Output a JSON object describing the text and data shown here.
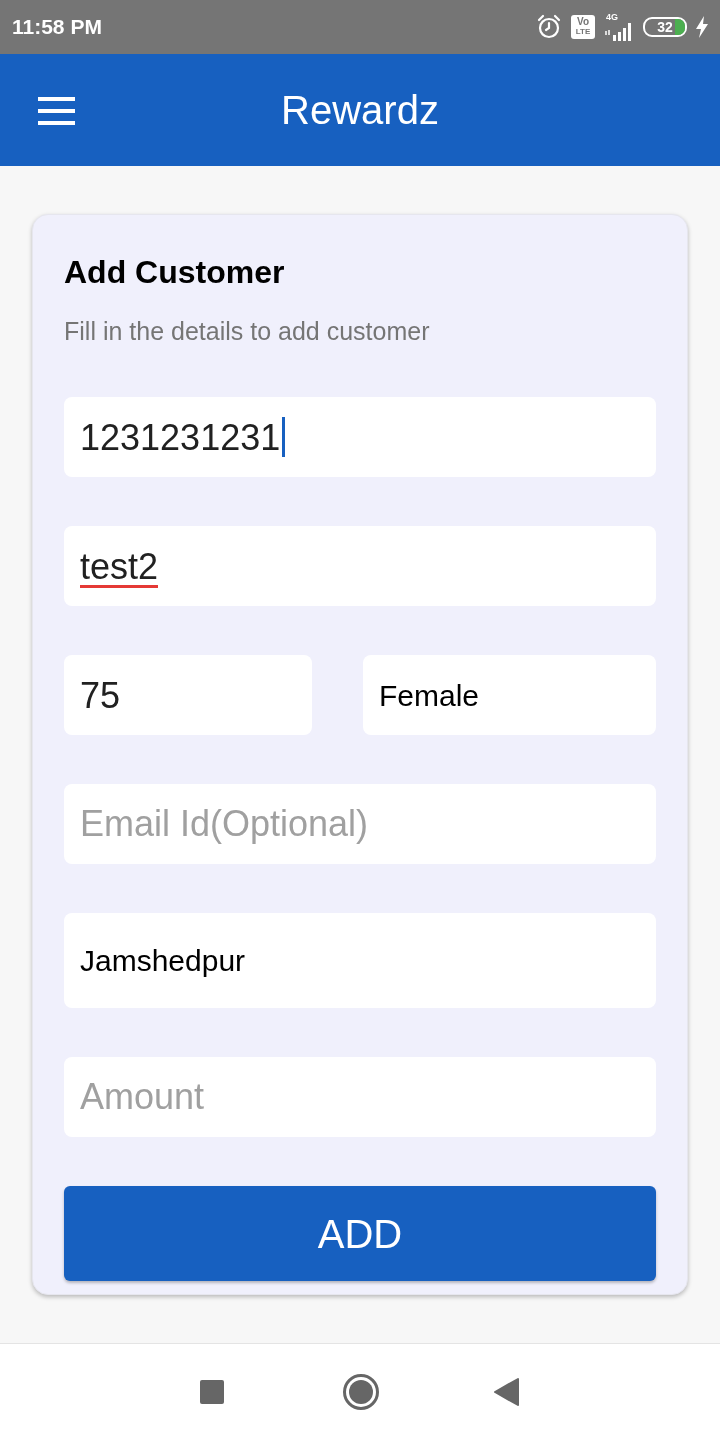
{
  "status_bar": {
    "time": "11:58 PM",
    "volte_top": "Vo",
    "volte_bottom": "LTE",
    "network": "4G",
    "battery": "32"
  },
  "app_bar": {
    "title": "Rewardz"
  },
  "form": {
    "title": "Add Customer",
    "subtitle": "Fill in the details to add customer",
    "rows": [
      {
        "fields": [
          {
            "kind": "input",
            "value": "1231231231",
            "focused": true,
            "misspelled": false
          }
        ]
      },
      {
        "fields": [
          {
            "kind": "input",
            "value": "test2",
            "focused": false,
            "misspelled": true
          }
        ]
      },
      {
        "fields": [
          {
            "kind": "input",
            "value": "75",
            "focused": false,
            "misspelled": false
          },
          {
            "kind": "picker",
            "value": "Female"
          }
        ]
      },
      {
        "fields": [
          {
            "kind": "input",
            "placeholder": "Email Id(Optional)"
          }
        ]
      },
      {
        "fields": [
          {
            "kind": "autocomplete",
            "value": "Jamshedpur"
          }
        ]
      },
      {
        "fields": [
          {
            "kind": "input",
            "placeholder": "Amount"
          }
        ]
      }
    ],
    "submit": "ADD"
  }
}
